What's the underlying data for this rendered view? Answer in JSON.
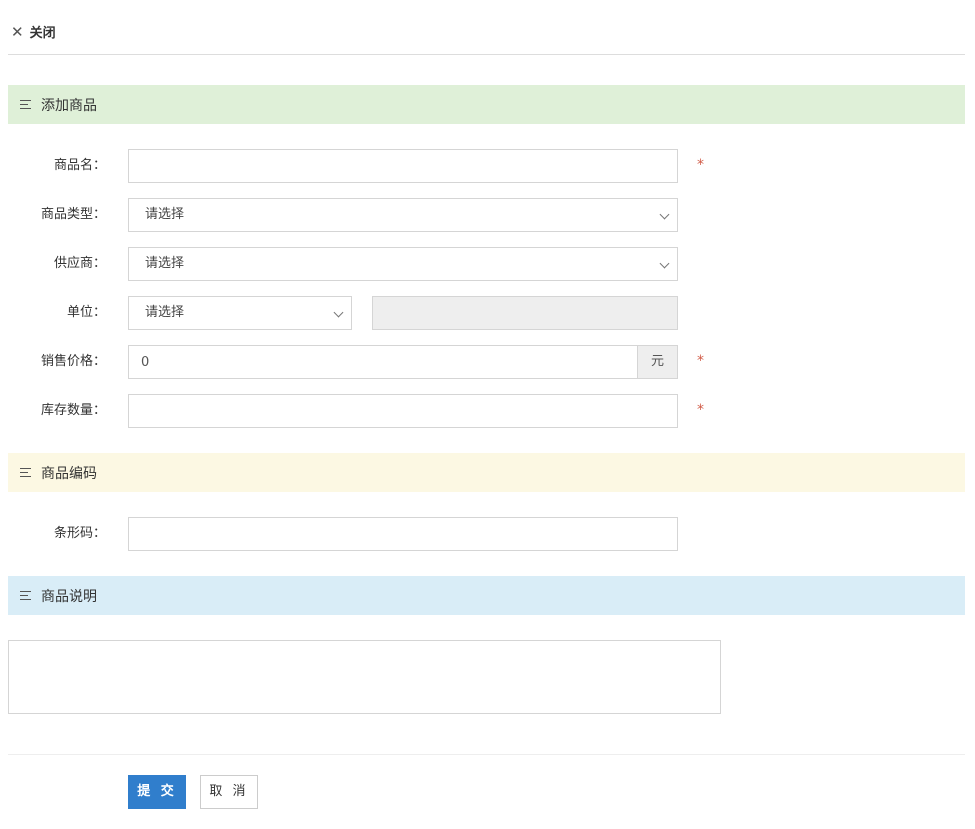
{
  "header": {
    "close_icon": "close-icon",
    "close_label": "关闭"
  },
  "sections": {
    "basic": {
      "title": "添加商品",
      "color": "#dff0d8"
    },
    "code": {
      "title": "商品编码",
      "color": "#fcf8e3"
    },
    "desc": {
      "title": "商品说明",
      "color": "#d9edf7"
    }
  },
  "form": {
    "name": {
      "label": "商品名：",
      "value": "",
      "required": "*"
    },
    "type": {
      "label": "商品类型：",
      "selected": "请选择"
    },
    "supplier": {
      "label": "供应商：",
      "selected": "请选择"
    },
    "unit": {
      "label": "单位：",
      "selected": "请选择",
      "extra_value": ""
    },
    "price": {
      "label": "销售价格：",
      "value": "0",
      "suffix": "元",
      "required": "*"
    },
    "stock": {
      "label": "库存数量：",
      "value": "",
      "required": "*"
    },
    "barcode": {
      "label": "条形码：",
      "value": ""
    },
    "description": {
      "value": ""
    }
  },
  "actions": {
    "submit": "提 交",
    "cancel": "取 消"
  },
  "colors": {
    "primary": "#307ecc",
    "required": "#d15b47"
  }
}
